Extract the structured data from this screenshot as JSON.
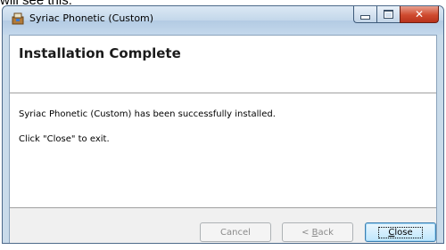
{
  "caption_fragment": "will see this:",
  "window": {
    "title": "Syriac Phonetic (Custom)",
    "icon": "installer-icon",
    "caption_buttons": {
      "minimize": "minimize-icon",
      "maximize": "maximize-icon",
      "close": "close-icon"
    }
  },
  "header": {
    "title": "Installation Complete"
  },
  "body": {
    "message": "Syriac Phonetic (Custom) has been successfully installed.",
    "instruction": "Click \"Close\" to exit."
  },
  "buttons": {
    "cancel": "Cancel",
    "back_prefix": "< ",
    "back_mnemonic": "B",
    "back_rest": "ack",
    "close_mnemonic": "C",
    "close_rest": "lose"
  },
  "colors": {
    "titlebar": "#c3d7ea",
    "close_button": "#cf4b2f",
    "default_button_border": "#3c7fb1"
  }
}
